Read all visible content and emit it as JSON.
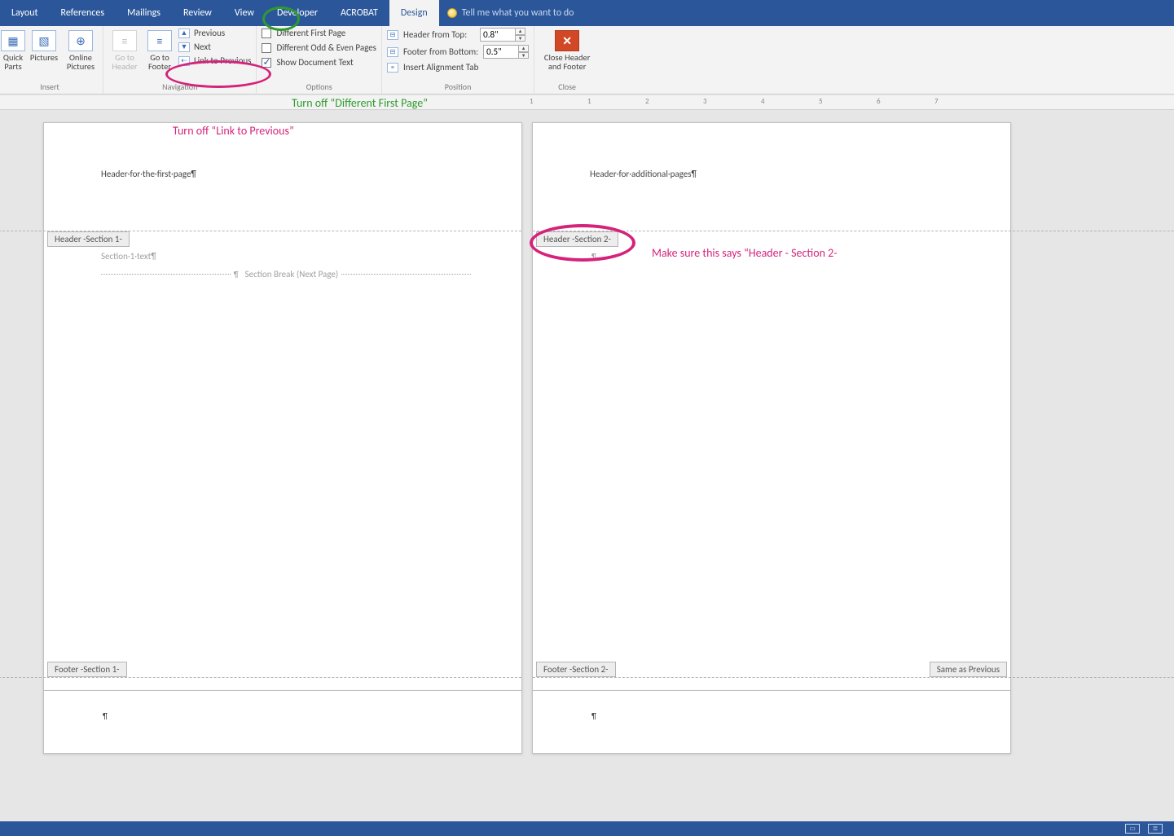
{
  "tabs": {
    "layout": "Layout",
    "references": "References",
    "mailings": "Mailings",
    "review": "Review",
    "view": "View",
    "developer": "Developer",
    "acrobat": "ACROBAT",
    "design": "Design"
  },
  "tellme": {
    "placeholder": "Tell me what you want to do"
  },
  "ribbon": {
    "insert": {
      "label": "Insert",
      "quick_parts": "Quick Parts",
      "pictures": "Pictures",
      "online_pictures": "Online Pictures"
    },
    "navigation": {
      "label": "Navigation",
      "go_to_header": "Go to Header",
      "go_to_footer": "Go to Footer",
      "previous": "Previous",
      "next": "Next",
      "link_to_previous": "Link to Previous"
    },
    "options": {
      "label": "Options",
      "different_first_page": "Different First Page",
      "different_odd_even": "Different Odd & Even Pages",
      "show_document_text": "Show Document Text",
      "different_first_page_checked": false,
      "different_odd_even_checked": false,
      "show_document_text_checked": true
    },
    "position": {
      "label": "Position",
      "header_from_top": "Header from Top:",
      "footer_from_bottom": "Footer from Bottom:",
      "insert_alignment_tab": "Insert Alignment Tab",
      "header_value": "0.8\"",
      "footer_value": "0.5\""
    },
    "close": {
      "label": "Close",
      "button": "Close Header and Footer"
    }
  },
  "annotations": {
    "turn_off_dfp": "Turn off “Different First Page”",
    "turn_off_ltp": "Turn off  “Link to Previous”",
    "make_sure": "Make sure this says “Header - Section 2-"
  },
  "page1": {
    "header_text": "Header·for·the·first·page¶",
    "header_tag": "Header -Section 1-",
    "body_line": "Section·1·text¶",
    "section_break": "Section Break (Next Page)",
    "footer_tag": "Footer -Section 1-"
  },
  "page2": {
    "header_text": "Header·for·additional·pages¶",
    "header_tag": "Header -Section 2-",
    "footer_tag": "Footer -Section 2-",
    "same_as_previous": "Same as Previous"
  },
  "ruler_numbers": [
    "1",
    "1",
    "2",
    "3",
    "4",
    "5",
    "6",
    "7"
  ],
  "paragraph_mark": "¶"
}
